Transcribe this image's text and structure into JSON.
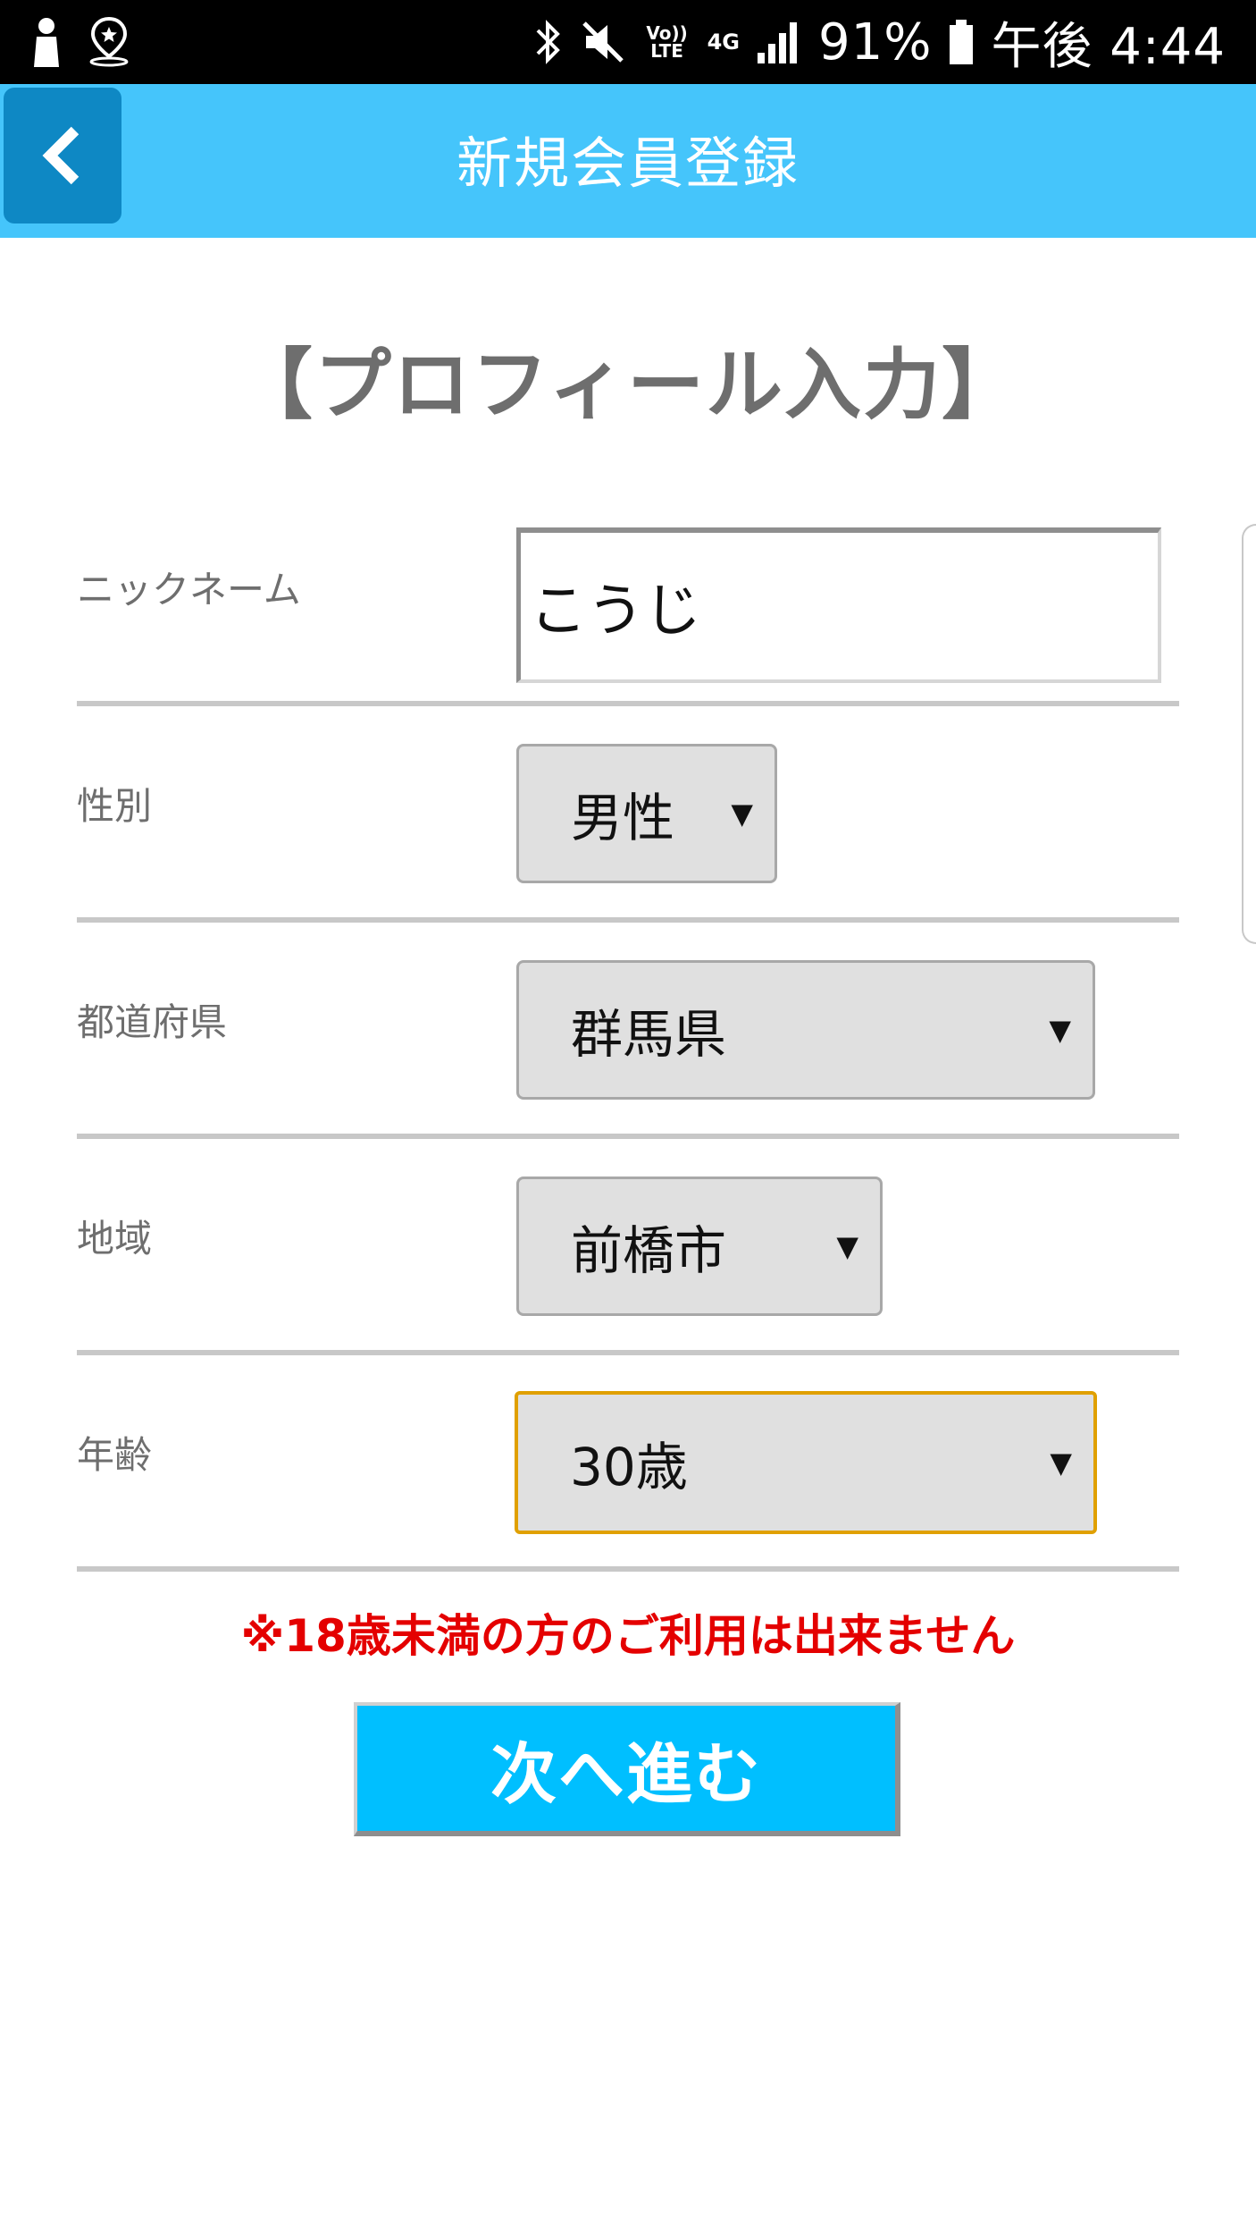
{
  "status_bar": {
    "network_volte": "Vo)) LTE",
    "network_4g": "4G",
    "battery": "91%",
    "time": "午後 4:44",
    "icons": [
      "person-icon",
      "location-pin-icon",
      "bluetooth-icon",
      "mute-icon",
      "signal-icon",
      "battery-icon"
    ]
  },
  "header": {
    "title": "新規会員登録",
    "back_icon": "chevron-left-icon"
  },
  "section_title": "【プロフィール入力】",
  "form": {
    "nickname": {
      "label": "ニックネーム",
      "value": "こうじ"
    },
    "gender": {
      "label": "性別",
      "value": "男性"
    },
    "prefecture": {
      "label": "都道府県",
      "value": "群馬県"
    },
    "area": {
      "label": "地域",
      "value": "前橋市"
    },
    "age": {
      "label": "年齢",
      "value": "30歳"
    }
  },
  "notice": "※18歳未満の方のご利用は出来ません",
  "next_button": "次へ進む",
  "colors": {
    "header": "#45c5fb",
    "back_button": "#0e88c4",
    "next_button": "#00bfff",
    "notice": "#e40000",
    "focus_border": "#e0a000"
  }
}
